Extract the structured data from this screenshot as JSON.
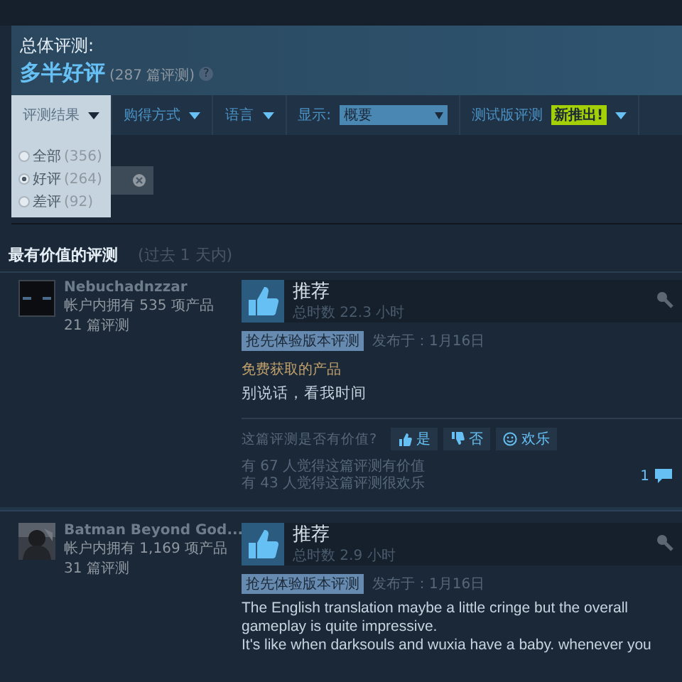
{
  "summary": {
    "label": "总体评测:",
    "rating": "多半好评",
    "count": "(287 篇评测)",
    "help": "?"
  },
  "filters": [
    {
      "kind": "menu",
      "label": "评测结果",
      "selected": true
    },
    {
      "kind": "menu",
      "label": "购得方式",
      "selected": false
    },
    {
      "kind": "menu",
      "label": "语言",
      "selected": false
    },
    {
      "kind": "select",
      "label": "显示:",
      "value": "概要"
    },
    {
      "kind": "badge",
      "label": "测试版评测",
      "badge": "新推出!"
    }
  ],
  "dropdown": {
    "options": [
      {
        "label": "全部",
        "count": "(356)",
        "selected": false
      },
      {
        "label": "好评",
        "count": "(264)",
        "selected": true
      },
      {
        "label": "差评",
        "count": "(92)",
        "selected": false
      }
    ]
  },
  "section": {
    "title": "最有价值的评测",
    "period": "(过去 1 天内)"
  },
  "reviews": [
    {
      "author": "Nebuchadnzzar",
      "products": "帐户内拥有 535 项产品",
      "count": "21 篇评测",
      "verdict": "推荐",
      "hours": "总时数 22.3 小时",
      "tag": "抢先体验版本评测",
      "posted": "发布于：1月16日",
      "note": "免费获取的产品",
      "body": [
        "别说话，看我时间"
      ],
      "helpful": {
        "question": "这篇评测是否有价值?",
        "yes": "是",
        "no": "否",
        "funny": "欢乐"
      },
      "stats": [
        "有 67 人觉得这篇评测有价值",
        "有 43 人觉得这篇评测很欢乐"
      ],
      "comments": "1"
    },
    {
      "author": "Batman Beyond God...",
      "products": "帐户内拥有 1,169 项产品",
      "count": "31 篇评测",
      "verdict": "推荐",
      "hours": "总时数 2.9 小时",
      "tag": "抢先体验版本评测",
      "posted": "发布于：1月16日",
      "body": [
        "The English translation maybe a little cringe but the overall gameplay is quite impressive.",
        "It's like when darksouls and wuxia have a baby. whenever you"
      ]
    }
  ]
}
